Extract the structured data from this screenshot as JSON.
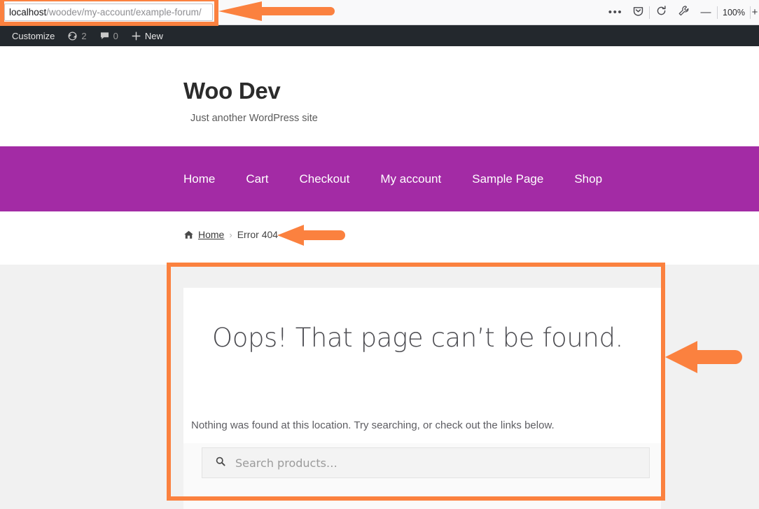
{
  "browser": {
    "url_host": "localhost",
    "url_path": "/woodev/my-account/example-forum/",
    "more_icon": "ellipsis-icon",
    "pocket_icon": "pocket-icon",
    "reload_icon": "reload-icon",
    "wrench_icon": "wrench-icon",
    "zoom_out_label": "—",
    "zoom_level": "100%",
    "zoom_in_label": "+"
  },
  "admin_bar": {
    "customize_label": "Customize",
    "updates_icon": "updates-icon",
    "updates_count": "2",
    "comments_icon": "comment-bubble-icon",
    "comments_count": "0",
    "new_icon": "plus-icon",
    "new_label": "New"
  },
  "site": {
    "title": "Woo Dev",
    "description": "Just another WordPress site",
    "nav_bg": "#a32ba5"
  },
  "nav": {
    "items": [
      {
        "label": "Home"
      },
      {
        "label": "Cart"
      },
      {
        "label": "Checkout"
      },
      {
        "label": "My account"
      },
      {
        "label": "Sample Page"
      },
      {
        "label": "Shop"
      }
    ]
  },
  "breadcrumb": {
    "home_icon": "home-icon",
    "home_label": "Home",
    "separator": "›",
    "current": "Error 404"
  },
  "main": {
    "error_title": "Oops! That page can’t be found.",
    "error_body": "Nothing was found at this location. Try searching, or check out the links below.",
    "search_icon": "search-icon",
    "search_placeholder": "Search products…",
    "search_value": ""
  },
  "annotations": {
    "highlight_color": "#fb813f",
    "boxes": [
      {
        "name": "url-bar-highlight"
      },
      {
        "name": "main-content-highlight"
      }
    ],
    "arrows": [
      {
        "name": "url-bar-arrow",
        "direction": "left"
      },
      {
        "name": "breadcrumb-arrow",
        "direction": "left"
      },
      {
        "name": "content-arrow",
        "direction": "left"
      }
    ]
  }
}
